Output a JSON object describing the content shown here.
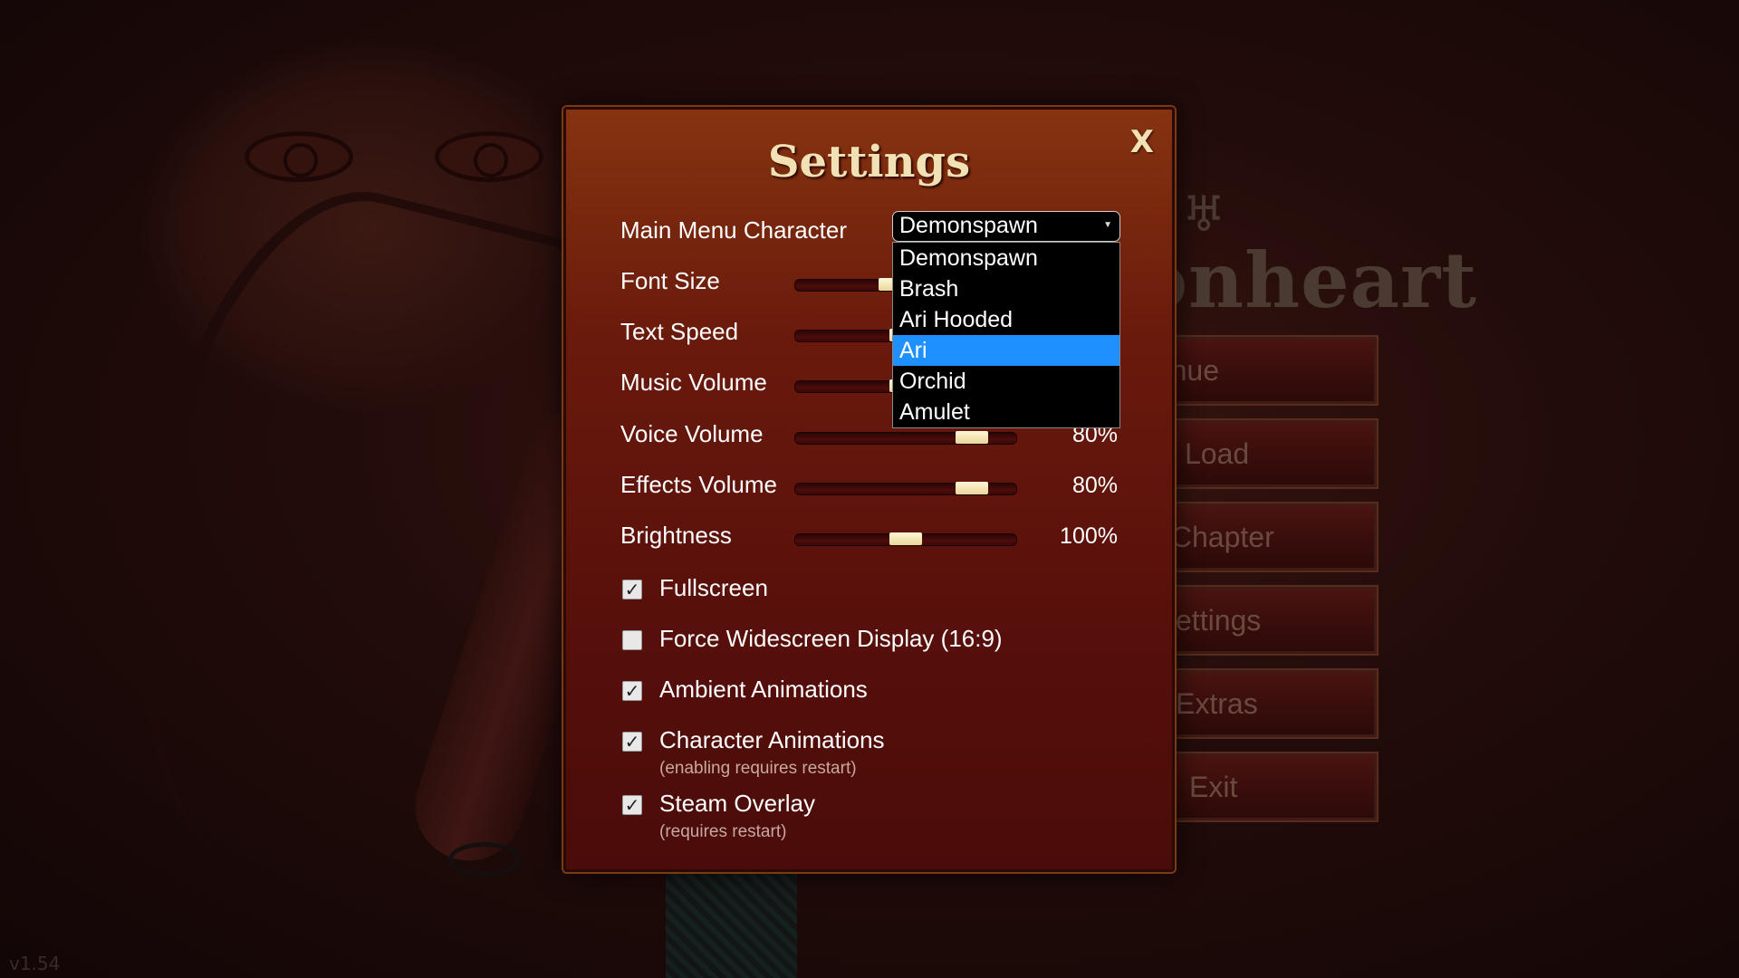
{
  "version": "v1.54",
  "logo": {
    "text": "onheart"
  },
  "main_menu": {
    "items": [
      {
        "label": "ontinue"
      },
      {
        "label": "Load"
      },
      {
        "label": "v Chapter"
      },
      {
        "label": "ettings"
      },
      {
        "label": "Extras"
      },
      {
        "label": "Exit"
      }
    ]
  },
  "settings": {
    "title": "Settings",
    "close_label": "X",
    "main_menu_character": {
      "label": "Main Menu Character",
      "selected": "Demonspawn",
      "options": [
        "Demonspawn",
        "Brash",
        "Ari Hooded",
        "Ari",
        "Orchid",
        "Amulet"
      ],
      "highlighted": "Ari"
    },
    "sliders": [
      {
        "label": "Font Size",
        "value": 0.45,
        "display": ""
      },
      {
        "label": "Text Speed",
        "value": 0.5,
        "display": ""
      },
      {
        "label": "Music Volume",
        "value": 0.5,
        "display": ""
      },
      {
        "label": "Voice Volume",
        "value": 0.8,
        "display": "80%"
      },
      {
        "label": "Effects Volume",
        "value": 0.8,
        "display": "80%"
      },
      {
        "label": "Brightness",
        "value": 0.5,
        "display": "100%"
      }
    ],
    "checkboxes": [
      {
        "label": "Fullscreen",
        "checked": true,
        "note": ""
      },
      {
        "label": "Force Widescreen Display (16:9)",
        "checked": false,
        "note": ""
      },
      {
        "label": "Ambient Animations",
        "checked": true,
        "note": ""
      },
      {
        "label": "Character Animations",
        "checked": true,
        "note": "(enabling requires restart)"
      },
      {
        "label": "Steam Overlay",
        "checked": true,
        "note": "(requires restart)"
      }
    ]
  },
  "colors": {
    "dialog_title": "#f1e1b4",
    "dropdown_highlight": "#1e90ff",
    "slider_thumb": "#f3e6b6"
  }
}
